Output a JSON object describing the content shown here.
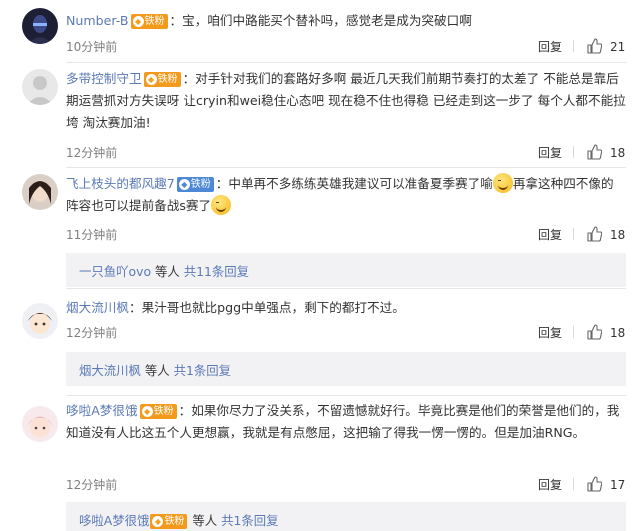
{
  "comments": [
    {
      "name": "Number-B",
      "badge": "铁粉",
      "sep": "：",
      "text": "宝，咱们中路能买个替补吗，感觉老是成为突破口啊",
      "time": "10分钟前",
      "reply": "回复",
      "likes": "21"
    },
    {
      "name": "多带控制守卫",
      "badge": "铁粉",
      "sep": "：",
      "text": "对手针对我们的套路好多啊 最近几天我们前期节奏打的太差了 不能总是靠后期运营抓对方失误呀 让cryin和wei稳住心态吧 现在稳不住也得稳 已经走到这一步了 每个人都不能拉垮 淘汰赛加油!",
      "time": "12分钟前",
      "reply": "回复",
      "likes": "18"
    },
    {
      "name": "飞上枝头的都风趣7",
      "badge": "铁粉",
      "sep": "：",
      "text_a": "中单再不多练练英雄我建议可以准备夏季赛了喻",
      "text_b": "再拿这种四不像的阵容也可以提前备战s赛了",
      "time": "11分钟前",
      "reply": "回复",
      "likes": "18"
    },
    {
      "name": "烟大流川枫",
      "sep": "：",
      "text": "果汁哥也就比pgg中单强点，剩下的都打不过。",
      "time": "12分钟前",
      "reply": "回复",
      "likes": "18"
    },
    {
      "name": "哆啦A梦很饿",
      "badge": "铁粉",
      "sep": "：",
      "text": "如果你尽力了没关系，不留遗憾就好行。毕竟比赛是他们的荣誉是他们的，我知道没有人比这五个人更想赢，我就是有点憋屈，这把输了得我一愣一愣的。但是加油RNG。",
      "time": "12分钟前",
      "reply": "回复",
      "likes": "17"
    }
  ],
  "reply_boxes": [
    {
      "name": "一只鱼吖ovo",
      "rest": " 等人 ",
      "more": "共11条回复"
    },
    {
      "name": "烟大流川枫",
      "rest": " 等人 ",
      "more": "共1条回复"
    },
    {
      "name": "哆啦A梦很饿",
      "rest": " 等人 ",
      "more": "共1条回复"
    }
  ],
  "icons": {
    "like": "thumbs-up-icon",
    "badge": "fan-badge-icon"
  },
  "colors": {
    "orange_name": "#eb7350",
    "blue_name": "#5b7ab6",
    "badge_gold": "#f39a1c",
    "badge_blue": "#4d88d7",
    "reply_box_bg": "#f2f2f5"
  }
}
